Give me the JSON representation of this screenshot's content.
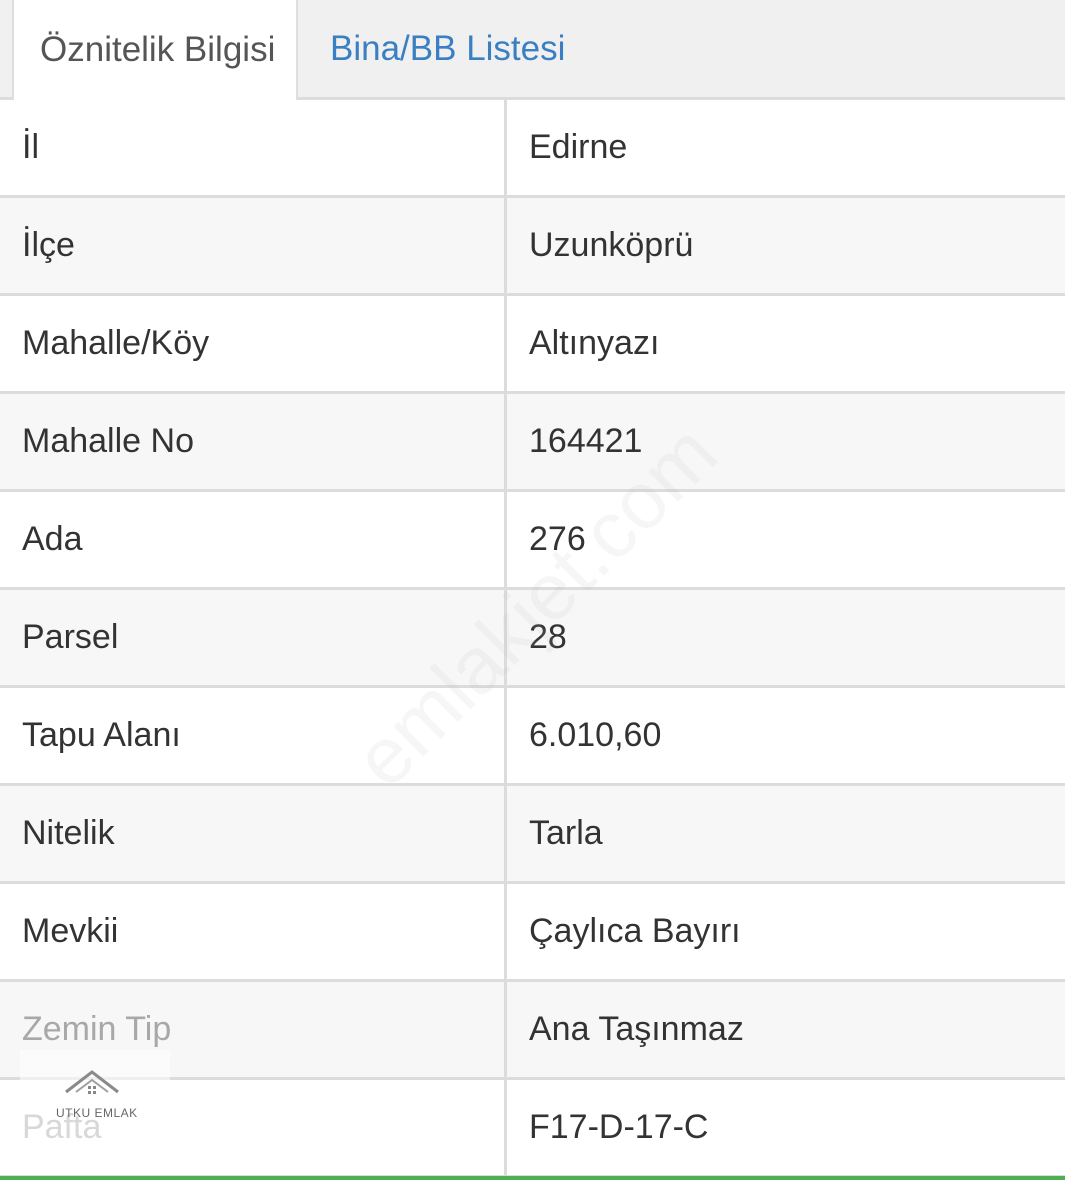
{
  "tabs": [
    {
      "label": "Öznitelik Bilgisi",
      "active": true
    },
    {
      "label": "Bina/BB Listesi",
      "active": false
    }
  ],
  "rows": [
    {
      "key": "İl",
      "value": "Edirne"
    },
    {
      "key": "İlçe",
      "value": "Uzunköprü"
    },
    {
      "key": "Mahalle/Köy",
      "value": "Altınyazı"
    },
    {
      "key": "Mahalle No",
      "value": "164421"
    },
    {
      "key": "Ada",
      "value": "276"
    },
    {
      "key": "Parsel",
      "value": "28"
    },
    {
      "key": "Tapu Alanı",
      "value": "6.010,60"
    },
    {
      "key": "Nitelik",
      "value": "Tarla"
    },
    {
      "key": "Mevkii",
      "value": "Çaylıca Bayırı"
    },
    {
      "key": "Zemin Tip",
      "value": "Ana Taşınmaz"
    },
    {
      "key": "Pafta",
      "value": "F17-D-17-C"
    }
  ],
  "watermark": "emlakjet.com",
  "logo_text": "UTKU EMLAK",
  "colors": {
    "tab_link": "#3a7fc1",
    "accent_bottom": "#4caf50",
    "border": "#dcdcdc"
  }
}
